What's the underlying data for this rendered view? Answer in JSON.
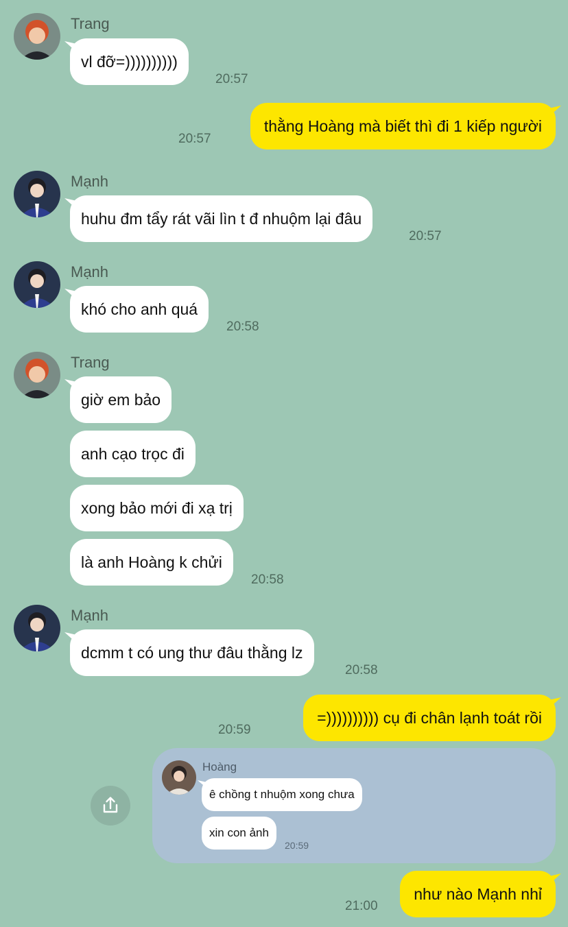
{
  "colors": {
    "background": "#9dc7b4",
    "incoming_bubble": "#ffffff",
    "outgoing_bubble": "#fde600",
    "forward_card": "#abc0d3"
  },
  "icons": {
    "share": "share-icon",
    "avatar_trang": "avatar-icon",
    "avatar_manh": "avatar-icon",
    "avatar_hoang": "avatar-icon"
  },
  "messages": [
    {
      "sender": "Trang",
      "text": "vl đỡ=))))))))))",
      "time": "20:57"
    },
    {
      "text": "thằng Hoàng mà biết thì đi 1 kiếp người",
      "time": "20:57"
    },
    {
      "sender": "Mạnh",
      "text": "huhu đm tẩy rát vãi lìn t đ nhuộm lại đâu",
      "time": "20:57"
    },
    {
      "sender": "Mạnh",
      "text": "khó cho anh quá",
      "time": "20:58"
    },
    {
      "sender": "Trang",
      "lines": [
        "giờ em bảo",
        "anh cạo trọc đi",
        "xong bảo mới đi xạ trị",
        "là anh Hoàng k chửi"
      ],
      "time": "20:58"
    },
    {
      "sender": "Mạnh",
      "text": "dcmm t có ung thư đâu thằng lz",
      "time": "20:58"
    },
    {
      "text": "=)))))))))) cụ đi chân lạnh toát rồi",
      "time": "20:59"
    },
    {
      "forwarded": {
        "sender": "Hoàng",
        "lines": [
          "ê chồng t nhuộm xong chưa",
          "xin con ảnh"
        ],
        "time": "20:59"
      }
    },
    {
      "text": "như nào Mạnh nhỉ",
      "time": "21:00"
    }
  ]
}
